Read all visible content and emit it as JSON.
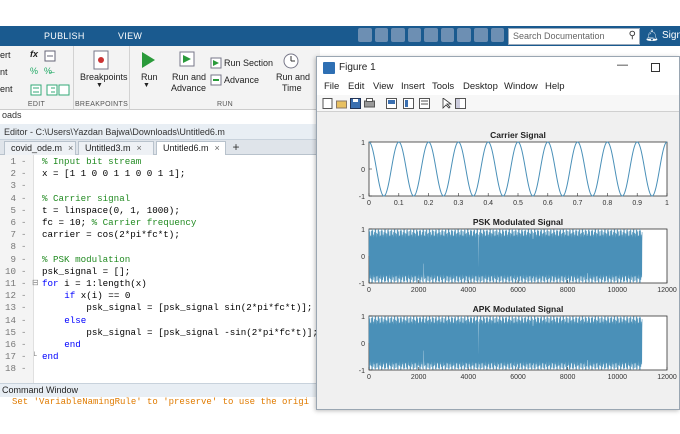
{
  "top_tabs": {
    "publish": "PUBLISH",
    "view": "VIEW"
  },
  "search": {
    "placeholder": "Search Documentation",
    "signin": "Sign"
  },
  "ribbon": {
    "edit_label": "EDIT",
    "breakpoints_btn": "Breakpoints",
    "breakpoints_label": "BREAKPOINTS",
    "run": "Run",
    "run_advance_1": "Run and",
    "run_advance_2": "Advance",
    "run_section": "Run Section",
    "advance": "Advance",
    "run_time_1": "Run and",
    "run_time_2": "Time",
    "run_label": "RUN",
    "left_clip": [
      "ert",
      "nt",
      "ent"
    ]
  },
  "file_line": "oads",
  "editor": {
    "title": "Editor - C:\\Users\\Yazdan Bajwa\\Downloads\\Untitled6.m",
    "tabs": [
      "covid_ode.m",
      "Untitled3.m",
      "Untitled6.m"
    ],
    "active_tab": 2,
    "lines": [
      {
        "n": "1",
        "indent": 0,
        "parts": [
          {
            "t": "% Input bit stream",
            "c": "c"
          }
        ]
      },
      {
        "n": "2",
        "indent": 0,
        "parts": [
          {
            "t": "x = [1 1 0 0 1 1 0 0 1 1];",
            "c": ""
          }
        ]
      },
      {
        "n": "3",
        "indent": 0,
        "parts": []
      },
      {
        "n": "4",
        "indent": 0,
        "parts": [
          {
            "t": "% Carrier signal",
            "c": "c"
          }
        ]
      },
      {
        "n": "5",
        "indent": 0,
        "parts": [
          {
            "t": "t = linspace(0, 1, 1000);",
            "c": ""
          }
        ]
      },
      {
        "n": "6",
        "indent": 0,
        "parts": [
          {
            "t": "fc = 10; ",
            "c": ""
          },
          {
            "t": "% Carrier frequency",
            "c": "c"
          }
        ]
      },
      {
        "n": "7",
        "indent": 0,
        "parts": [
          {
            "t": "carrier = cos(2*pi*fc*t);",
            "c": ""
          }
        ]
      },
      {
        "n": "8",
        "indent": 0,
        "parts": []
      },
      {
        "n": "9",
        "indent": 0,
        "parts": [
          {
            "t": "% PSK modulation",
            "c": "c"
          }
        ]
      },
      {
        "n": "10",
        "indent": 0,
        "parts": [
          {
            "t": "psk_signal = [];",
            "c": ""
          }
        ]
      },
      {
        "n": "11",
        "indent": -1,
        "parts": [
          {
            "t": "for ",
            "c": "kw"
          },
          {
            "t": "i = 1:length(x)",
            "c": ""
          }
        ]
      },
      {
        "n": "12",
        "indent": 2,
        "parts": [
          {
            "t": "if ",
            "c": "kw"
          },
          {
            "t": "x(i) == 0",
            "c": ""
          }
        ]
      },
      {
        "n": "13",
        "indent": 4,
        "parts": [
          {
            "t": "psk_signal = [psk_signal sin(2*pi*fc*t)];",
            "c": ""
          }
        ]
      },
      {
        "n": "14",
        "indent": 2,
        "parts": [
          {
            "t": "else",
            "c": "kw"
          }
        ]
      },
      {
        "n": "15",
        "indent": 4,
        "parts": [
          {
            "t": "psk_signal = [psk_signal -sin(2*pi*fc*t)];",
            "c": ""
          }
        ]
      },
      {
        "n": "16",
        "indent": 2,
        "parts": [
          {
            "t": "end",
            "c": "kw"
          }
        ]
      },
      {
        "n": "17",
        "indent": -1,
        "parts": [
          {
            "t": "end",
            "c": "kw"
          }
        ]
      },
      {
        "n": "18",
        "indent": 0,
        "parts": []
      }
    ]
  },
  "command_window": {
    "title": "Command Window",
    "text": "Set 'VariableNamingRule' to 'preserve' to use the origi"
  },
  "figure": {
    "title": "Figure 1",
    "menu": [
      "File",
      "Edit",
      "View",
      "Insert",
      "Tools",
      "Desktop",
      "Window",
      "Help"
    ]
  },
  "chart_data": [
    {
      "type": "line",
      "title": "Carrier Signal",
      "function": "cos(2*pi*10*t)",
      "xlim": [
        0,
        1
      ],
      "ylim": [
        -1,
        1
      ],
      "xticks": [
        "0",
        "0.1",
        "0.2",
        "0.3",
        "0.4",
        "0.5",
        "0.6",
        "0.7",
        "0.8",
        "0.9",
        "1"
      ],
      "yticks": [
        "1",
        "0",
        "-1"
      ],
      "color": "#4a90b8"
    },
    {
      "type": "line",
      "title": "PSK Modulated Signal",
      "samples": 11000,
      "xlim": [
        0,
        12000
      ],
      "ylim": [
        -1,
        1
      ],
      "xticks": [
        "0",
        "2000",
        "4000",
        "6000",
        "8000",
        "10000",
        "12000"
      ],
      "yticks": [
        "1",
        "0",
        "-1"
      ],
      "color": "#4a90b8"
    },
    {
      "type": "line",
      "title": "APK Modulated Signal",
      "samples": 11000,
      "xlim": [
        0,
        12000
      ],
      "ylim": [
        -1,
        1
      ],
      "xticks": [
        "0",
        "2000",
        "4000",
        "6000",
        "8000",
        "10000",
        "12000"
      ],
      "yticks": [
        "1",
        "0",
        "-1"
      ],
      "color": "#4a90b8"
    }
  ]
}
